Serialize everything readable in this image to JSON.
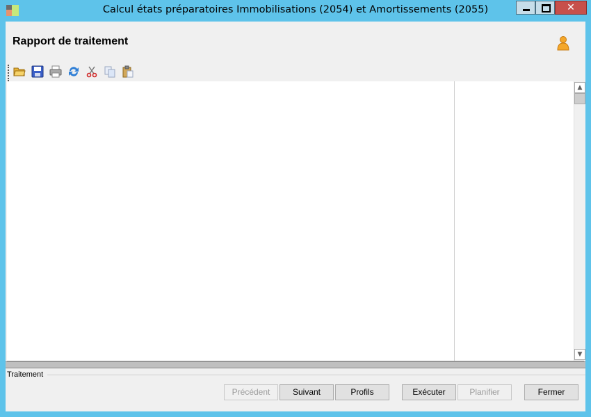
{
  "window": {
    "title": "Calcul états préparatoires Immobilisations (2054) et Amortissements (2055)",
    "close_glyph": "✕"
  },
  "header": {
    "title": "Rapport de traitement"
  },
  "toolbar": {
    "items": [
      {
        "icon": "folder-open-icon"
      },
      {
        "icon": "save-icon"
      },
      {
        "icon": "print-icon"
      },
      {
        "icon": "refresh-icon"
      },
      {
        "icon": "cut-icon"
      },
      {
        "icon": "copy-icon"
      },
      {
        "icon": "paste-icon"
      }
    ]
  },
  "scroll": {
    "up": "▲",
    "down": "▼"
  },
  "group": {
    "label": "Traitement"
  },
  "buttons": {
    "previous": "Précédent",
    "next": "Suivant",
    "profiles": "Profils",
    "execute": "Exécuter",
    "schedule": "Planifier",
    "close": "Fermer"
  },
  "colors": {
    "frame": "#5ec3ea",
    "client": "#f0f0f0",
    "close_button": "#c7504b"
  }
}
